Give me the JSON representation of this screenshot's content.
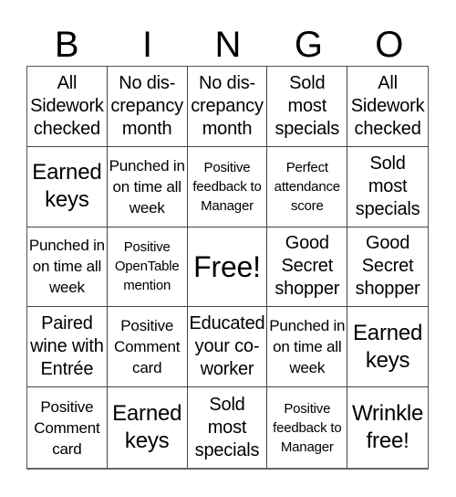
{
  "header": [
    "B",
    "I",
    "N",
    "G",
    "O"
  ],
  "board": [
    [
      {
        "text": "All Sidework checked",
        "size": "md"
      },
      {
        "text": "No dis-crepancy month",
        "size": "md"
      },
      {
        "text": "No dis-crepancy month",
        "size": "md"
      },
      {
        "text": "Sold most specials",
        "size": "md"
      },
      {
        "text": "All Sidework checked",
        "size": "md"
      }
    ],
    [
      {
        "text": "Earned keys",
        "size": "lg"
      },
      {
        "text": "Punched in on time all week",
        "size": "sm"
      },
      {
        "text": "Positive feedback to Manager",
        "size": "xs"
      },
      {
        "text": "Perfect attendance score",
        "size": "xs"
      },
      {
        "text": "Sold most specials",
        "size": "md"
      }
    ],
    [
      {
        "text": "Punched in on time all week",
        "size": "sm"
      },
      {
        "text": "Positive OpenTable mention",
        "size": "xs"
      },
      {
        "text": "Free!",
        "size": "free"
      },
      {
        "text": "Good Secret shopper",
        "size": "md"
      },
      {
        "text": "Good Secret shopper",
        "size": "md"
      }
    ],
    [
      {
        "text": "Paired wine with Entrée",
        "size": "md"
      },
      {
        "text": "Positive Comment card",
        "size": "sm"
      },
      {
        "text": "Educated your co-worker",
        "size": "md"
      },
      {
        "text": "Punched in on time all week",
        "size": "sm"
      },
      {
        "text": "Earned keys",
        "size": "lg"
      }
    ],
    [
      {
        "text": "Positive Comment card",
        "size": "sm"
      },
      {
        "text": "Earned keys",
        "size": "lg"
      },
      {
        "text": "Sold most specials",
        "size": "md"
      },
      {
        "text": "Positive feedback to Manager",
        "size": "xs"
      },
      {
        "text": "Wrinkle free!",
        "size": "lg"
      }
    ]
  ]
}
